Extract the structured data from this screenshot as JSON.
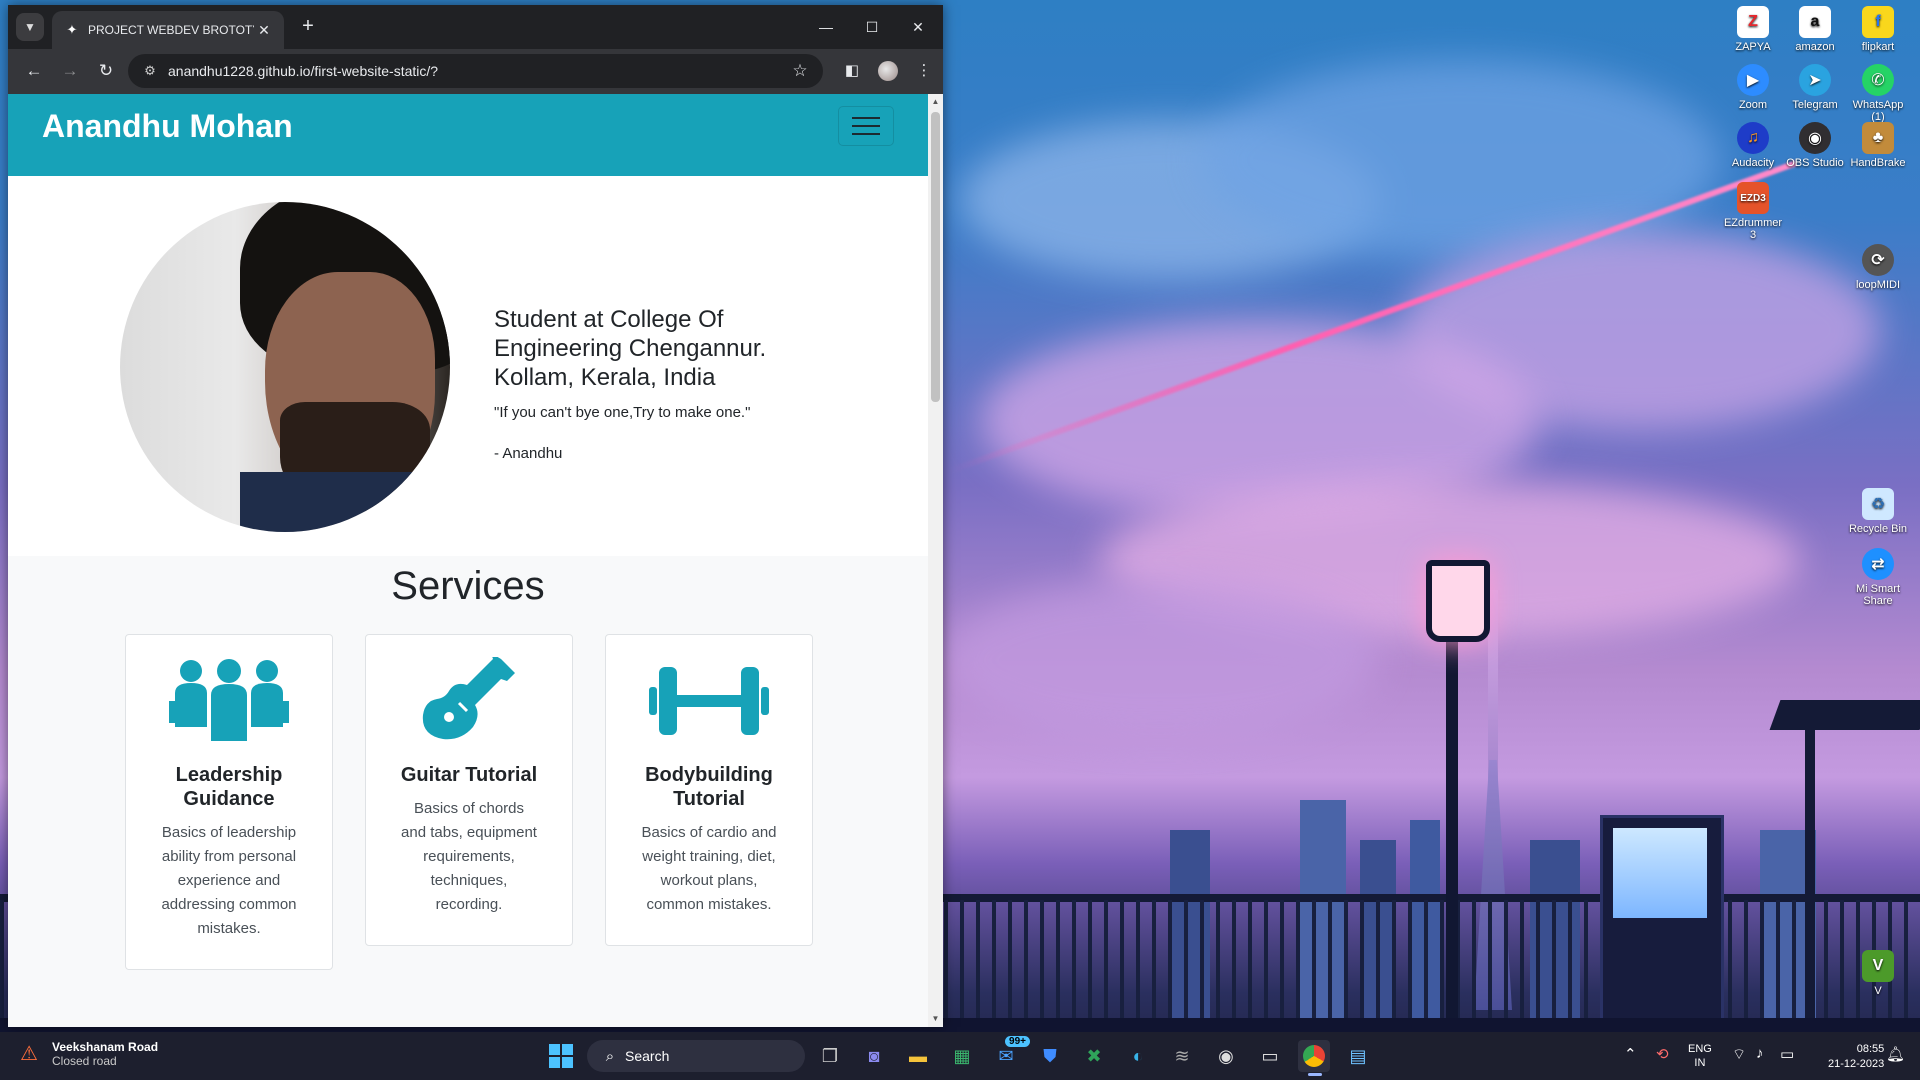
{
  "browser": {
    "tab_title": "PROJECT WEBDEV BROTOTYPE",
    "url": "anandhu1228.github.io/first-website-static/?"
  },
  "page": {
    "brand": "Anandhu Mohan",
    "hero_title": "Student at College Of Engineering Chengannur. Kollam, Kerala, India",
    "quote": "\"If you can't bye one,Try to make one.\"",
    "author": "- Anandhu",
    "services_title": "Services",
    "services": [
      {
        "title": "Leadership Guidance",
        "text": "Basics of leadership ability from personal experience and addressing common mistakes.",
        "icon": "people-group-icon"
      },
      {
        "title": "Guitar Tutorial",
        "text": "Basics of chords and tabs, equipment requirements, techniques, recording.",
        "icon": "guitar-icon"
      },
      {
        "title": "Bodybuilding Tutorial",
        "text": "Basics of cardio and weight training, diet, workout plans, common mistakes.",
        "icon": "dumbbell-icon"
      }
    ]
  },
  "desktop_icons": [
    {
      "label": "ZAPYA",
      "icon": "zapya-icon",
      "color": "#e8262b"
    },
    {
      "label": "amazon",
      "icon": "amazon-icon",
      "color": "#ffffff"
    },
    {
      "label": "flipkart",
      "icon": "flipkart-icon",
      "color": "#f9d71c"
    },
    {
      "label": "Zoom",
      "icon": "zoom-icon",
      "color": "#2d8cff"
    },
    {
      "label": "Telegram",
      "icon": "telegram-icon",
      "color": "#2aa3e0"
    },
    {
      "label": "WhatsApp (1)",
      "icon": "whatsapp-icon",
      "color": "#25d366"
    },
    {
      "label": "Audacity",
      "icon": "audacity-icon",
      "color": "#1e3cc8"
    },
    {
      "label": "OBS Studio",
      "icon": "obs-icon",
      "color": "#302e31"
    },
    {
      "label": "HandBrake",
      "icon": "handbrake-icon",
      "color": "#c28b3b"
    },
    {
      "label": "EZdrummer 3",
      "icon": "ezdrummer-icon",
      "color": "#e5532a"
    },
    {
      "label": "loopMIDI",
      "icon": "loopmidi-icon",
      "color": "#555555"
    },
    {
      "label": "Recycle Bin",
      "icon": "recycle-bin-icon",
      "color": "#cfe8ff"
    },
    {
      "label": "Mi Smart Share",
      "icon": "mi-share-icon",
      "color": "#1e90ff"
    },
    {
      "label": "V",
      "icon": "vivado-icon",
      "color": "#4c9a2a"
    }
  ],
  "taskbar": {
    "weather_title": "Veekshanam Road",
    "weather_sub": "Closed road",
    "search_label": "Search",
    "mail_badge": "99+",
    "lang_top": "ENG",
    "lang_bottom": "IN",
    "time": "08:55",
    "date": "21-12-2023"
  },
  "colors": {
    "navbar": "#17a2b8",
    "service_icon": "#17a2b8"
  }
}
